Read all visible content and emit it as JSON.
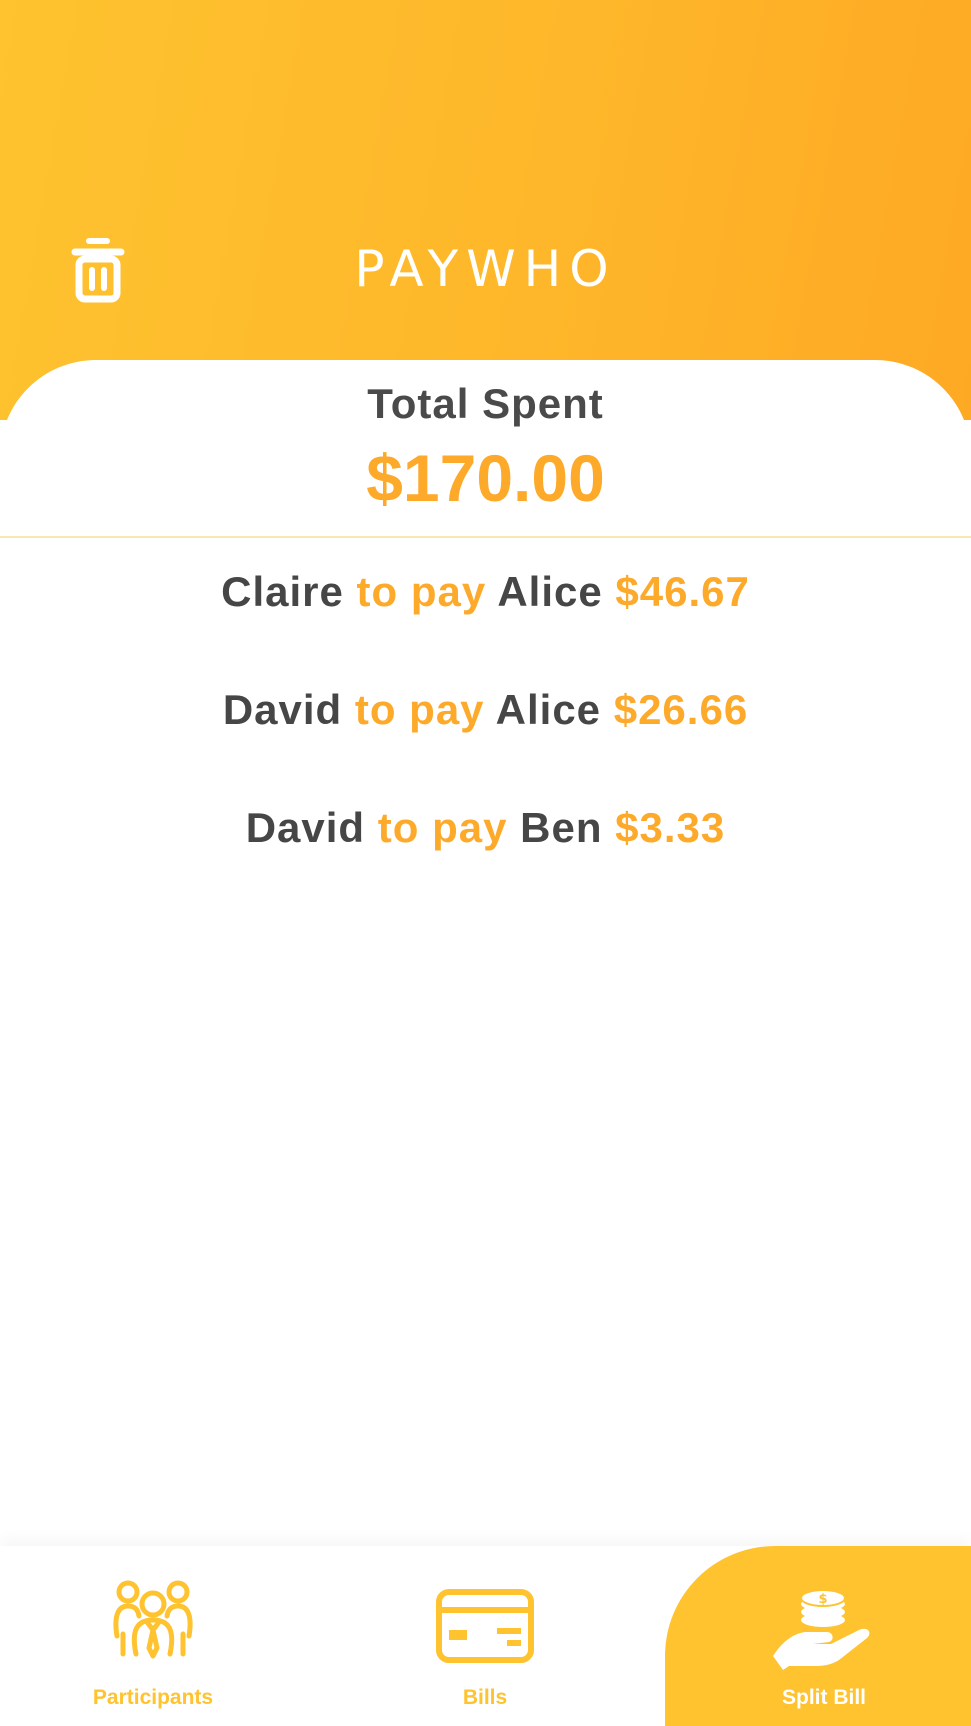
{
  "header": {
    "title": "PAYWHO",
    "trash_icon": "trash-icon",
    "gradient": [
      "#fec32f",
      "#fea924"
    ]
  },
  "summary": {
    "label": "Total Spent",
    "amount": "$170.00"
  },
  "payments": [
    {
      "payer": "Claire",
      "verb": " to pay ",
      "payee": "Alice",
      "amount": "$46.67"
    },
    {
      "payer": "David",
      "verb": " to pay ",
      "payee": "Alice",
      "amount": "$26.66"
    },
    {
      "payer": "David",
      "verb": " to pay ",
      "payee": "Ben",
      "amount": "$3.33"
    }
  ],
  "tabs": [
    {
      "label": "Participants",
      "icon": "participants-icon",
      "active": false
    },
    {
      "label": "Bills",
      "icon": "credit-card-icon",
      "active": false
    },
    {
      "label": "Split Bill",
      "icon": "hand-coins-icon",
      "active": true
    }
  ],
  "colors": {
    "accent": "#fda92a",
    "tab_accent": "#fec32f",
    "text_dark": "#464646"
  }
}
